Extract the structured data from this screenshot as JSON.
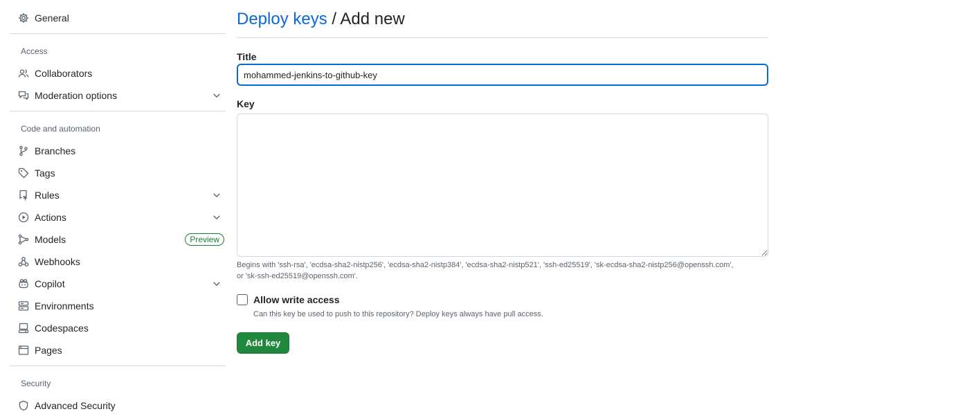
{
  "sidebar": {
    "general": {
      "label": "General",
      "icon": "gear-icon"
    },
    "access": {
      "heading": "Access",
      "items": [
        {
          "label": "Collaborators",
          "icon": "people-icon"
        },
        {
          "label": "Moderation options",
          "icon": "comment-discussion-icon",
          "expandable": true
        }
      ]
    },
    "code_automation": {
      "heading": "Code and automation",
      "items": [
        {
          "label": "Branches",
          "icon": "git-branch-icon"
        },
        {
          "label": "Tags",
          "icon": "tag-icon"
        },
        {
          "label": "Rules",
          "icon": "repo-push-icon",
          "expandable": true
        },
        {
          "label": "Actions",
          "icon": "play-icon",
          "expandable": true
        },
        {
          "label": "Models",
          "icon": "models-icon",
          "badge": "Preview"
        },
        {
          "label": "Webhooks",
          "icon": "webhook-icon"
        },
        {
          "label": "Copilot",
          "icon": "copilot-icon",
          "expandable": true
        },
        {
          "label": "Environments",
          "icon": "server-icon"
        },
        {
          "label": "Codespaces",
          "icon": "codespaces-icon"
        },
        {
          "label": "Pages",
          "icon": "browser-icon"
        }
      ]
    },
    "security": {
      "heading": "Security",
      "items": [
        {
          "label": "Advanced Security",
          "icon": "shield-icon"
        }
      ]
    }
  },
  "main": {
    "breadcrumb_link": "Deploy keys",
    "breadcrumb_rest": " / Add new",
    "title_label": "Title",
    "title_value": "mohammed-jenkins-to-github-key",
    "key_label": "Key",
    "key_value": "",
    "hint_line1": "Begins with 'ssh-rsa', 'ecdsa-sha2-nistp256', 'ecdsa-sha2-nistp384', 'ecdsa-sha2-nistp521', 'ssh-ed25519', 'sk-ecdsa-sha2-nistp256@openssh.com',",
    "hint_line2": "or 'sk-ssh-ed25519@openssh.com'.",
    "allow_write_label": "Allow write access",
    "allow_write_checked": false,
    "allow_write_desc": "Can this key be used to push to this repository? Deploy keys always have pull access.",
    "submit_label": "Add key"
  },
  "colors": {
    "link": "#0969da",
    "primary_button": "#1f883d",
    "badge": "#1a7f37",
    "focus_border": "#0969da"
  }
}
